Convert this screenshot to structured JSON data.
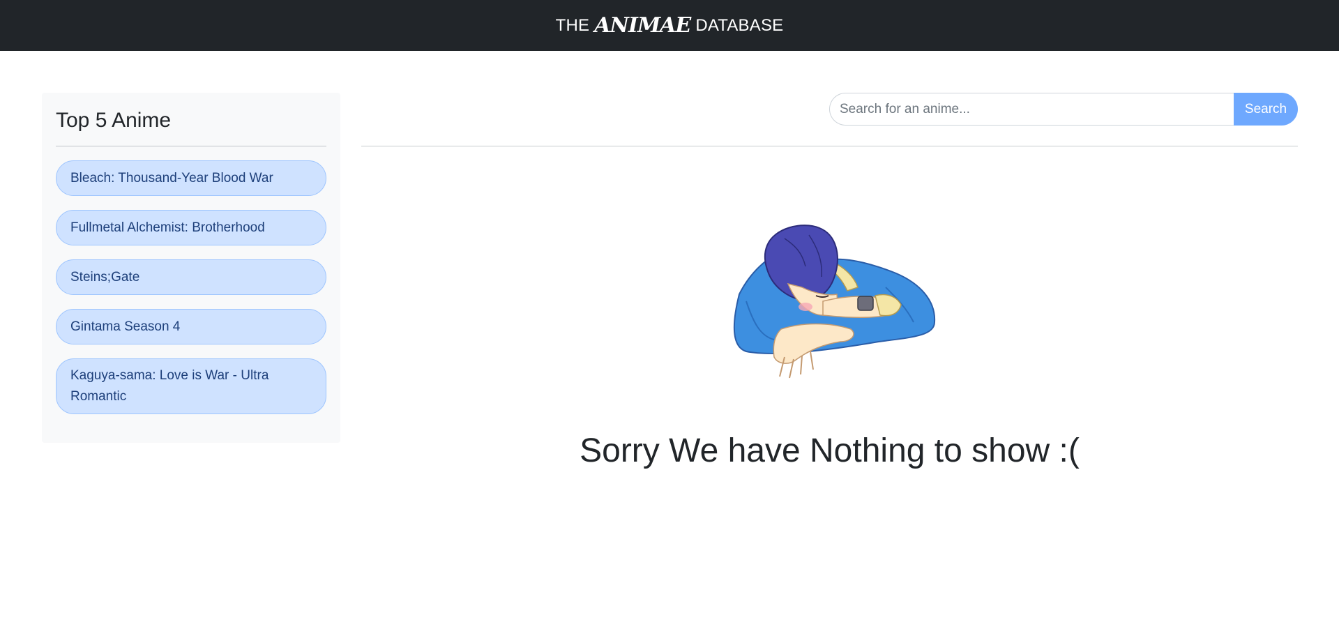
{
  "header": {
    "brand_prefix": "THE",
    "brand_middle": "ANIMAE",
    "brand_suffix": "DATABASE"
  },
  "sidebar": {
    "title": "Top 5 Anime",
    "items": [
      {
        "label": "Bleach: Thousand-Year Blood War"
      },
      {
        "label": "Fullmetal Alchemist: Brotherhood"
      },
      {
        "label": "Steins;Gate"
      },
      {
        "label": "Gintama Season 4"
      },
      {
        "label": "Kaguya-sama: Love is War - Ultra Romantic"
      }
    ]
  },
  "search": {
    "placeholder": "Search for an anime...",
    "value": "",
    "button_label": "Search"
  },
  "main": {
    "empty_message": "Sorry We have Nothing to show :(",
    "illustration": "sleeping-anime-boy-illustration"
  },
  "colors": {
    "navbar_bg": "#212529",
    "pill_bg": "#cfe2ff",
    "pill_text": "#1d3f7a",
    "search_button": "#6ea8fe",
    "sidebar_bg": "#f8f9fa"
  }
}
